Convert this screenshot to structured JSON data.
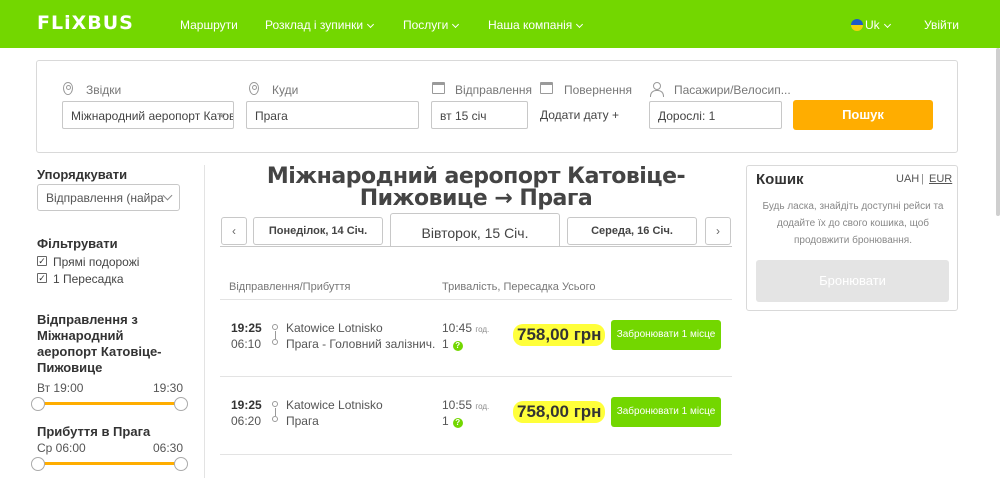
{
  "header": {
    "logo": "FLiXBUS",
    "nav": [
      {
        "label": "Маршрути",
        "dropdown": false
      },
      {
        "label": "Розклад і зупинки",
        "dropdown": true
      },
      {
        "label": "Послуги",
        "dropdown": true
      },
      {
        "label": "Наша компанія",
        "dropdown": true
      }
    ],
    "language": "Uk",
    "login": "Увійти"
  },
  "search": {
    "from_label": "Звідки",
    "from_value": "Міжнародний аеропорт Катовіце-Пижовице",
    "to_label": "Куди",
    "to_value": "Прага",
    "departure_label": "Відправлення",
    "departure_value": "вт 15 січ",
    "return_label": "Повернення",
    "return_value": "Додати дату +",
    "passengers_label": "Пасажири/Велосип...",
    "passengers_value": "Дорослі: 1",
    "search_button": "Пошук"
  },
  "sidebar": {
    "sort_title": "Упорядкувати",
    "sort_value": "Відправлення (найра",
    "filter_title": "Фільтрувати",
    "filters": [
      {
        "label": "Прямі подорожі",
        "checked": true
      },
      {
        "label": "1 Пересадка",
        "checked": true
      }
    ],
    "departure_title": "Відправлення з Міжнародний аеропорт Катовіце-Пижовице",
    "departure_min": "Вт 19:00",
    "departure_max": "19:30",
    "arrival_title": "Прибуття в Прага",
    "arrival_min": "Ср 06:00",
    "arrival_max": "06:30"
  },
  "main": {
    "route_title": "Міжнародний аеропорт Катовіце-Пижовице → Прага",
    "prev_arrow": "‹",
    "next_arrow": "›",
    "dates": [
      {
        "label": "Понеділок, 14 Січ.",
        "active": false
      },
      {
        "label": "Вівторок, 15 Січ.",
        "active": true
      },
      {
        "label": "Середа, 16 Січ.",
        "active": false
      }
    ],
    "columns": {
      "times": "Відправлення/Прибуття",
      "duration": "Тривалість, Пересадка",
      "total": "Усього"
    },
    "rides": [
      {
        "dep_time": "19:25",
        "arr_time": "06:10",
        "dep_station": "Katowice Lotnisko",
        "arr_station": "Прага - Головний залізнич...",
        "duration": "10:45",
        "duration_unit": "год.",
        "transfers": "1",
        "price": "758,00 грн",
        "book": "Забронювати 1 місце"
      },
      {
        "dep_time": "19:25",
        "arr_time": "06:20",
        "dep_station": "Katowice Lotnisko",
        "arr_station": "Прага",
        "duration": "10:55",
        "duration_unit": "год.",
        "transfers": "1",
        "price": "758,00 грн",
        "book": "Забронювати 1 місце"
      }
    ]
  },
  "cart": {
    "title": "Кошик",
    "currency_uah": "UAH",
    "currency_eur": "EUR",
    "currency_separator": "|",
    "message": "Будь ласка, знайдіть доступні рейси та додайте їх до свого кошика, щоб продовжити бронювання.",
    "button": "Бронювати"
  },
  "colors": {
    "brand_green": "#73d700",
    "accent_orange": "#ffad00",
    "price_highlight": "#ffff3a"
  }
}
